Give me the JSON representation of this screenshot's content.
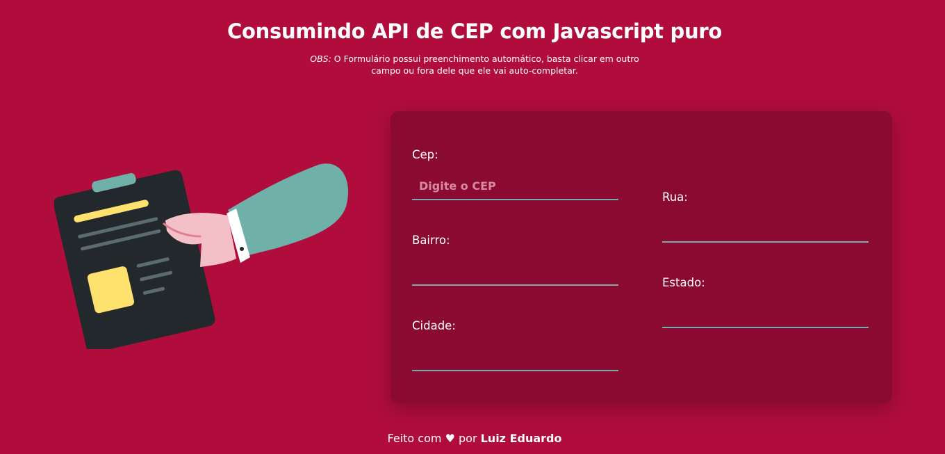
{
  "header": {
    "title": "Consumindo API de CEP com Javascript puro",
    "obs_label": "OBS:",
    "obs_text": " O Formulário possui preenchimento automático, basta clicar em outro campo ou fora dele que ele vai auto-completar."
  },
  "illustration": {
    "icon": "clipboard-hand-illustration",
    "colors": {
      "board": "#23282d",
      "clip": "#6fb0a8",
      "yellow": "#ffe26e",
      "lines": "#5b6b70",
      "sleeve": "#6fb0a8",
      "hand": "#f4c0c8"
    }
  },
  "form": {
    "fields": [
      {
        "label": "Cep:",
        "value": "",
        "placeholder": "Digite o CEP"
      },
      {
        "label": "Rua:",
        "value": "",
        "placeholder": ""
      },
      {
        "label": "Bairro:",
        "value": "",
        "placeholder": ""
      },
      {
        "label": "Estado:",
        "value": "",
        "placeholder": ""
      },
      {
        "label": "Cidade:",
        "value": "",
        "placeholder": ""
      }
    ]
  },
  "footer": {
    "prefix": "Feito com ",
    "heart": "♥",
    "middle": " por ",
    "author": "Luiz Eduardo"
  },
  "colors": {
    "background": "#b00d3d",
    "card": "#8b0a31",
    "underline": "#77aaa8"
  }
}
